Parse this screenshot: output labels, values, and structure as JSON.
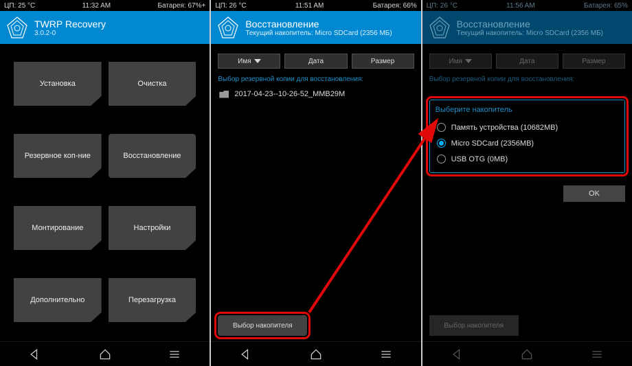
{
  "panel1": {
    "status": {
      "cpu": "ЦП: 25 °C",
      "time": "11:32 AM",
      "battery": "Батарея: 67%+"
    },
    "title": "TWRP Recovery",
    "subtitle": "3.0.2-0",
    "tiles": [
      "Установка",
      "Очистка",
      "Резервное коп-ние",
      "Восстановление",
      "Монтирование",
      "Настройки",
      "Дополнительно",
      "Перезагрузка"
    ]
  },
  "panel2": {
    "status": {
      "cpu": "ЦП: 26 °C",
      "time": "11:51 AM",
      "battery": "Батарея: 66%"
    },
    "title": "Восстановление",
    "subtitle": "Текущий накопитель: Micro SDCard (2356 МБ)",
    "sort": [
      "Имя",
      "Дата",
      "Размер"
    ],
    "section": "Выбор резервной копии для восстановления:",
    "file": "2017-04-23--10-26-52_MMB29M",
    "bottom": "Выбор накопителя"
  },
  "panel3": {
    "status": {
      "cpu": "ЦП: 26 °C",
      "time": "11:56 AM",
      "battery": "Батарея: 65%"
    },
    "title": "Восстановление",
    "subtitle": "Текущий накопитель: Micro SDCard (2356 МБ)",
    "sort": [
      "Имя",
      "Дата",
      "Размер"
    ],
    "section": "Выбор резервной копии для восстановления:",
    "dialog_title": "Выберите накопитель",
    "options": [
      "Память устройства (10682MB)",
      "Micro SDCard (2356MB)",
      "USB OTG (0MB)"
    ],
    "ok": "OK",
    "bottom": "Выбор накопителя"
  }
}
